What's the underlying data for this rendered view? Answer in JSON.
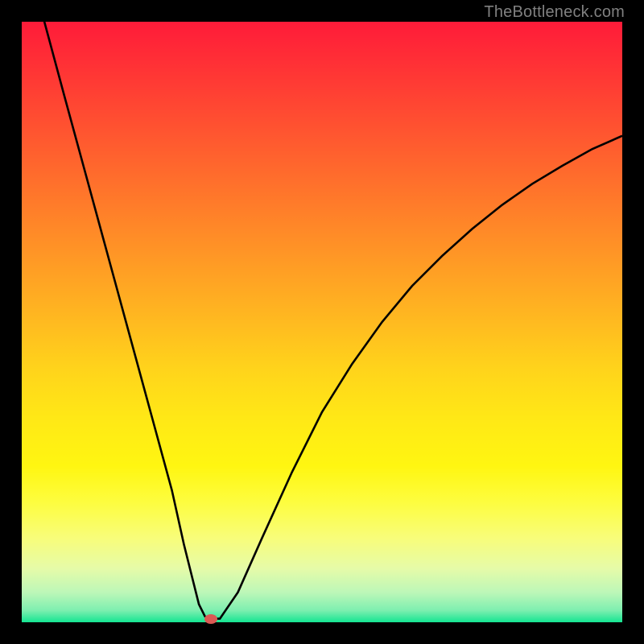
{
  "watermark": "TheBottleneck.com",
  "colors": {
    "curve_stroke": "#000000",
    "dot_fill": "#db5a54",
    "background_black": "#000000",
    "gradient_top": "#ff1b39",
    "gradient_bottom": "#14e592"
  },
  "chart_data": {
    "type": "line",
    "title": "",
    "xlabel": "",
    "ylabel": "",
    "xlim": [
      0,
      100
    ],
    "ylim": [
      0,
      100
    ],
    "x": [
      3.5,
      7,
      10,
      13,
      16,
      19,
      22,
      25,
      27,
      28.5,
      29.5,
      30.5,
      31.5,
      33,
      36,
      40,
      45,
      50,
      55,
      60,
      65,
      70,
      75,
      80,
      85,
      90,
      95,
      100
    ],
    "values": [
      101,
      88,
      77,
      66,
      55,
      44,
      33,
      22,
      13,
      7,
      3,
      1,
      0.6,
      0.6,
      5,
      14,
      25,
      35,
      43,
      50,
      56,
      61,
      65.5,
      69.5,
      73,
      76,
      78.8,
      81
    ],
    "marker": {
      "x": 31.5,
      "y": 0.6
    },
    "annotations": []
  }
}
